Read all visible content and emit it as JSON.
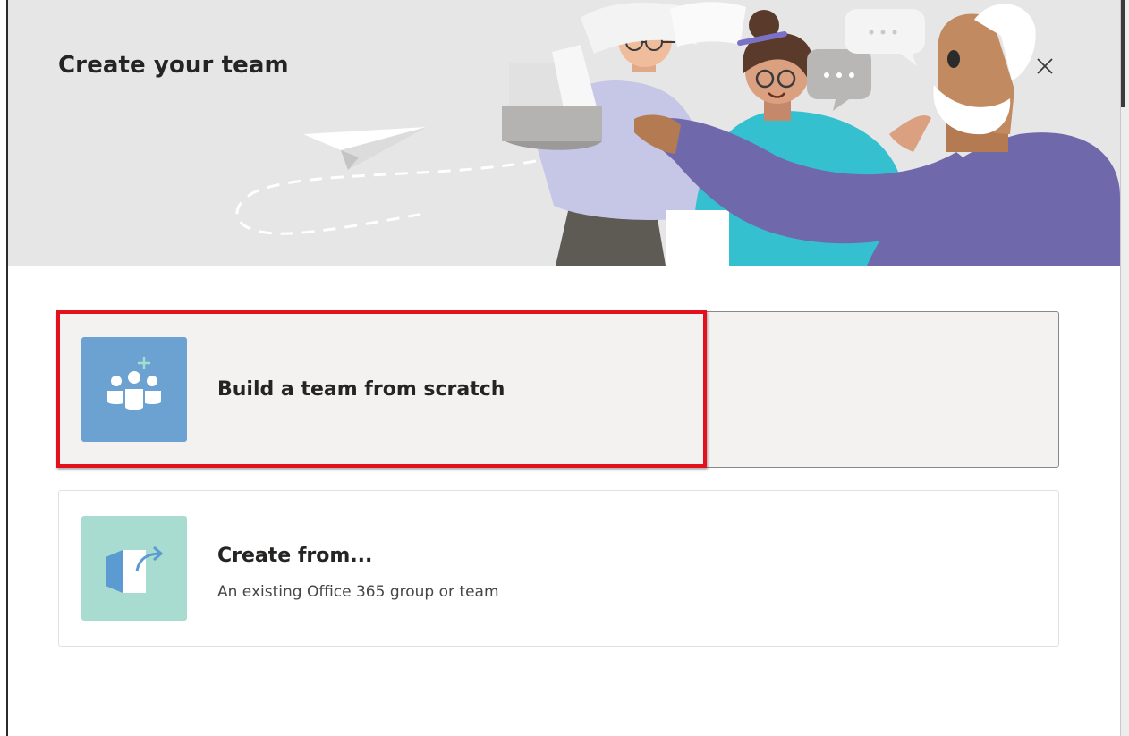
{
  "dialog": {
    "title": "Create your team",
    "close_icon": "close-icon"
  },
  "options": [
    {
      "title": "Build a team from scratch",
      "icon": "team-add-icon",
      "tile_color": "#6ba2d2",
      "selected": true
    },
    {
      "title": "Create from...",
      "description": "An existing Office 365 group or team",
      "icon": "create-from-existing-icon",
      "tile_color": "#a8dcd1"
    }
  ],
  "colors": {
    "header_bg": "#e6e6e6",
    "highlight": "#e3111c",
    "accent_purple": "#7068a8"
  }
}
